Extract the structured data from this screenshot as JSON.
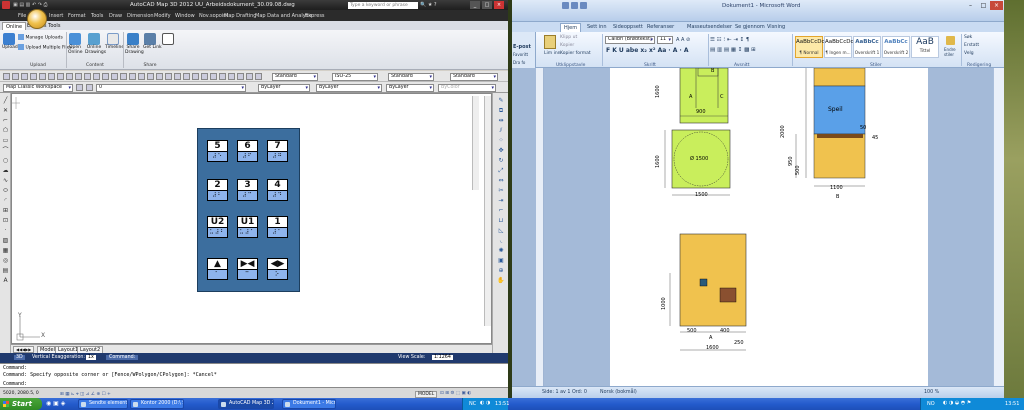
{
  "autocad": {
    "title": "AutoCAD Map 3D 2012   UU_Arbeidsdokument_30.09.08.dwg",
    "search_placeholder": "Type a keyword or phrase",
    "menus": [
      "File",
      "Edit",
      "Insert",
      "Format",
      "Tools",
      "Draw",
      "Dimension",
      "Modify",
      "Window",
      "Nov.sopoint",
      "Map Drafting",
      "Map Data and Analysis",
      "Express"
    ],
    "ribbon_tabs": [
      "Online",
      "Express Tools"
    ],
    "ribbon": {
      "upload": "Upload",
      "manage_uploads": "Manage Uploads",
      "upload_multiple": "Upload Multiple Files",
      "open_online": "Open Online",
      "online_drawings": "Online Drawings",
      "timeline": "Timeline",
      "share_drawing": "Share Drawing",
      "get_link": "Get Link",
      "group_upload": "Upload",
      "group_content": "Content",
      "group_share": "Share"
    },
    "toolbar1": {
      "style1": "Standard",
      "dimstyle": "ISO-25",
      "style3": "Standard",
      "style4": "Standard"
    },
    "toolbar2": {
      "workspace": "Map Classic Workspace",
      "layer": "0",
      "color": "ByLayer",
      "linetype": "ByLayer",
      "lineweight": "ByLayer",
      "plotstyle": "ByColor"
    },
    "panel_keys": [
      {
        "label": "5",
        "braille": "⠼⠑"
      },
      {
        "label": "6",
        "braille": "⠼⠋"
      },
      {
        "label": "7",
        "braille": "⠼⠛"
      },
      {
        "label": "2",
        "braille": "⠼⠃"
      },
      {
        "label": "3",
        "braille": "⠼⠉"
      },
      {
        "label": "4",
        "braille": "⠼⠙"
      },
      {
        "label": "U2",
        "braille": "⠥⠼⠃"
      },
      {
        "label": "U1",
        "braille": "⠥⠼⠁"
      },
      {
        "label": "1",
        "braille": "⠼⠁"
      },
      {
        "label": "▲",
        "braille": "⠁"
      },
      {
        "label": "▶◀",
        "braille": "⠉"
      },
      {
        "label": "◀▶",
        "braille": "⠕"
      }
    ],
    "layout_tabs": [
      "Model",
      "Layout1",
      "Layout2"
    ],
    "status": {
      "mode": "3D",
      "vert": "Vertical Exaggeration:",
      "vert_val": "1x",
      "command": "Command:",
      "view_scale": "View Scale:",
      "scale": "1:8264",
      "scale_val": "1:1264"
    },
    "cmd_lines": [
      "Command:",
      "Command: Specify opposite corner or [Fence/WPolygon/CPolygon]: *Cancel*",
      "Command:"
    ],
    "coords": "5020, 2080.5, 0",
    "model_label": "MODEL",
    "axis_y": "Y",
    "axis_x": "X"
  },
  "word": {
    "title": "Dokument1 - Microsoft Word",
    "tabs": [
      "Hjem",
      "Sett inn",
      "Sideoppsett",
      "Referanser",
      "Masseutsendelser",
      "Se gjennom",
      "Visning"
    ],
    "clipboard": {
      "paste": "Lim inn",
      "cut": "Klipp ut",
      "copy": "Kopier",
      "format": "Kopier format",
      "group": "Utklippstavle"
    },
    "font": {
      "name": "Calibri (Brødtekst)",
      "size": "11",
      "group": "Skrift"
    },
    "paragraph_group": "Avsnitt",
    "styles": [
      {
        "preview": "AaBbCcDc",
        "name": "¶ Normal"
      },
      {
        "preview": "AaBbCcDc",
        "name": "¶ Ingen m..."
      },
      {
        "preview": "AaBbCc",
        "name": "Overskrift 1"
      },
      {
        "preview": "AaBbCc",
        "name": "Overskrift 2"
      },
      {
        "preview": "AaB",
        "name": "Tittel"
      }
    ],
    "change_styles": "Endre stiler",
    "styles_group": "Stiler",
    "editing": {
      "find": "Søk",
      "replace": "Erstatt",
      "select": "Velg",
      "group": "Redigering"
    },
    "outlook": [
      "E-posti",
      "Favoritt",
      "Alle e-p",
      "E-postm",
      "Fo",
      "Ko",
      "Op",
      "14 elementer"
    ],
    "outlook_header": "E-post",
    "outlook_sub": "Dra fo",
    "status": {
      "page": "Side: 1 av 1",
      "words": "Ord: 0",
      "lang": "Norsk (bokmål)",
      "zoom": "100 %"
    },
    "drawing": {
      "top_left": {
        "dims": [
          "1600",
          "1600",
          "900",
          "1500"
        ],
        "labels": [
          "A",
          "C",
          "B"
        ],
        "circle": "Ø 1500"
      },
      "top_right": {
        "mirror": "Speil",
        "dims": [
          "2000",
          "950",
          "500",
          "1100",
          "50",
          "45"
        ],
        "label": "B"
      },
      "bottom": {
        "dims": [
          "1000",
          "500",
          "400",
          "250",
          "1600"
        ],
        "label": "A"
      }
    }
  },
  "taskbar": {
    "start": "Start",
    "items": [
      "Sendte elementer - M...",
      "Kontor 2000 (D:\\ Sa...",
      "AutoCAD Map 3D 201...",
      "Dokument1 - Microsof..."
    ],
    "tray_lang": "NC",
    "time": "13:51",
    "tray2_lang": "NO"
  },
  "colors": {
    "panel": "#3c6e9e",
    "braille": "#8eb4ec",
    "yellow": "#f0c24e",
    "green": "#c9ee5c",
    "mirror": "#5aa0e8"
  }
}
